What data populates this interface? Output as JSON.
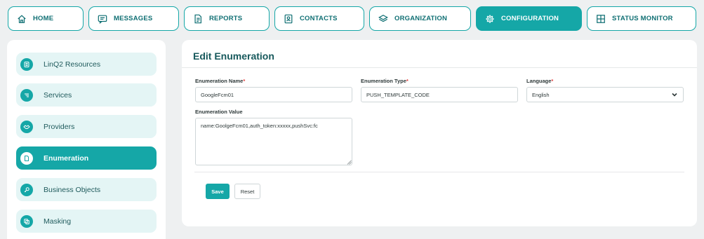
{
  "nav": {
    "tabs": [
      {
        "label": "HOME",
        "icon": "home-icon"
      },
      {
        "label": "MESSAGES",
        "icon": "message-icon"
      },
      {
        "label": "REPORTS",
        "icon": "report-icon"
      },
      {
        "label": "CONTACTS",
        "icon": "contact-card-icon"
      },
      {
        "label": "ORGANIZATION",
        "icon": "layers-icon"
      },
      {
        "label": "CONFIGURATION",
        "icon": "gear-icon",
        "active": true
      },
      {
        "label": "STATUS MONITOR",
        "icon": "grid-icon"
      }
    ]
  },
  "sidebar": {
    "items": [
      {
        "label": "LinQ2 Resources",
        "icon": "database-icon"
      },
      {
        "label": "Services",
        "icon": "list-icon"
      },
      {
        "label": "Providers",
        "icon": "handshake-icon"
      },
      {
        "label": "Enumeration",
        "icon": "document-icon",
        "active": true
      },
      {
        "label": "Business Objects",
        "icon": "key-icon"
      },
      {
        "label": "Masking",
        "icon": "copy-icon"
      }
    ]
  },
  "form": {
    "title": "Edit Enumeration",
    "name": {
      "label": "Enumeration Name",
      "value": "GoogleFcm01"
    },
    "type": {
      "label": "Enumeration Type",
      "value": "PUSH_TEMPLATE_CODE"
    },
    "language": {
      "label": "Language",
      "value": "English"
    },
    "enum_value": {
      "label": "Enumeration Value",
      "value": "name:GoolgeFcm01,auth_token:xxxxx,pushSvc:fc"
    },
    "required_mark": "*",
    "save_label": "Save",
    "reset_label": "Reset"
  },
  "colors": {
    "accent": "#15a7a7",
    "accent_light": "#e4f5f5",
    "title_text": "#17595c",
    "required": "#e03b3b",
    "background": "#eef0f1"
  }
}
